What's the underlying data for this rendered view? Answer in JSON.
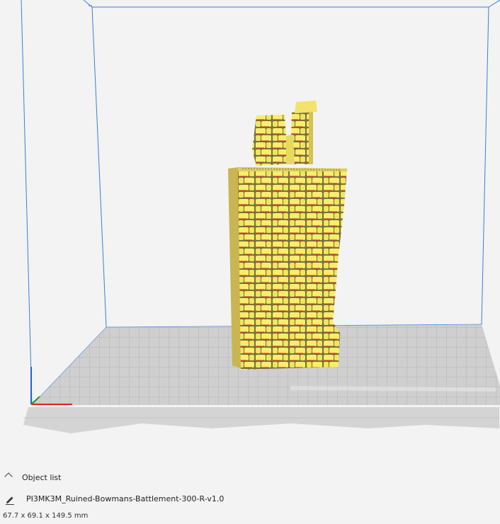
{
  "viewport": {
    "model_color": "#f5ea62",
    "overhang_color": "#e02020",
    "volume_edge_color": "#3a7fd4",
    "axis_colors": {
      "x": "#e02020",
      "y": "#22a022",
      "z": "#2060e0"
    }
  },
  "object_list": {
    "toggle_label": "Object list",
    "file_name": "PI3MK3M_Ruined-Bowmans-Battlement-300-R-v1.0",
    "dimensions": "67.7 x 69.1 x 149.5 mm"
  },
  "icons": {
    "collapse": "chevron-up-icon",
    "edit": "pencil-icon"
  }
}
